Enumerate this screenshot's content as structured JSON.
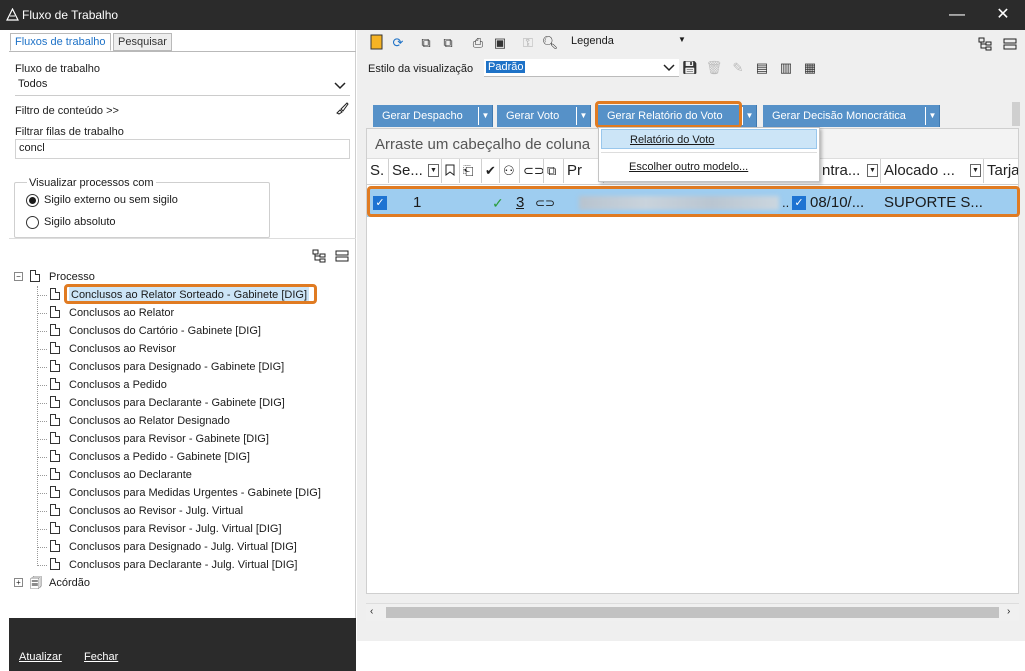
{
  "window": {
    "title": "Fluxo de Trabalho",
    "minimize": "—",
    "close": "✕"
  },
  "tabs": {
    "fluxos": "Fluxos de trabalho",
    "pesquisar": "Pesquisar"
  },
  "filters": {
    "fluxo_label": "Fluxo de trabalho",
    "fluxo_value": "Todos",
    "filtro_conteudo": "Filtro de conteúdo >>",
    "filtrar_label": "Filtrar filas de trabalho",
    "filtrar_value": "concl"
  },
  "visualizar": {
    "legend": "Visualizar processos com",
    "opt1": "Sigilo externo ou sem sigilo",
    "opt2": "Sigilo absoluto",
    "selected": "opt1"
  },
  "tree": {
    "root": "Processo",
    "items": [
      "Conclusos ao Relator Sorteado - Gabinete [DIG]",
      "Conclusos ao Relator",
      "Conclusos do Cartório - Gabinete [DIG]",
      "Conclusos ao Revisor",
      "Conclusos para Designado - Gabinete [DIG]",
      "Conclusos a Pedido",
      "Conclusos para Declarante - Gabinete [DIG]",
      "Conclusos ao Relator Designado",
      "Conclusos para Revisor - Gabinete [DIG]",
      "Conclusos a Pedido - Gabinete [DIG]",
      "Conclusos ao Declarante",
      "Conclusos para Medidas Urgentes - Gabinete [DIG]",
      "Conclusos ao Revisor - Julg. Virtual",
      "Conclusos para Revisor - Julg. Virtual [DIG]",
      "Conclusos para Designado - Julg. Virtual [DIG]",
      "Conclusos para Declarante - Julg. Virtual [DIG]"
    ],
    "selected_index": 0,
    "second_root": "Acórdão"
  },
  "bottom": {
    "atualizar": "Atualizar",
    "fechar": "Fechar"
  },
  "toolbar": {
    "legenda": "Legenda",
    "estilo_label": "Estilo da visualização",
    "estilo_value": "Padrão"
  },
  "actions": {
    "despacho": "Gerar Despacho",
    "voto": "Gerar Voto",
    "relatorio": "Gerar Relatório do Voto",
    "decisao": "Gerar Decisão Monocrática"
  },
  "menu": {
    "item1": "Relatório do Voto",
    "item2": "Escolher outro modelo..."
  },
  "grid": {
    "group_hint": "Arraste um cabeçalho de coluna",
    "headers": {
      "s": "S.",
      "seq": "Se...",
      "pr": "Pr",
      "entrada": "ntra...",
      "alocado": "Alocado ...",
      "tarja": "Tarja"
    },
    "row": {
      "seq": "1",
      "count": "3",
      "date": "08/10/...",
      "alocado": "SUPORTE S..."
    }
  },
  "colors": {
    "accent": "#5691c8",
    "highlight": "#e07b22",
    "selection": "#9ecdf0"
  }
}
